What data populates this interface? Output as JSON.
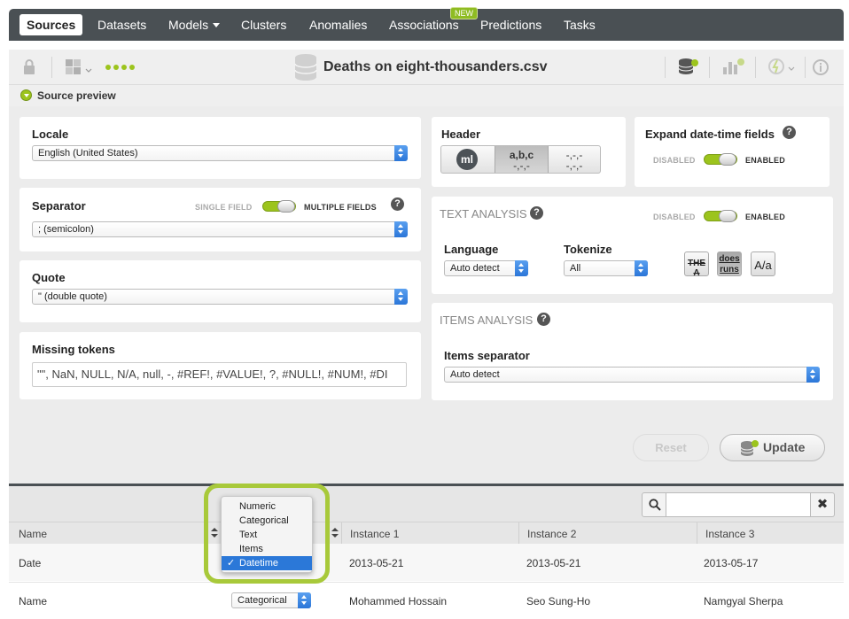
{
  "nav": {
    "items": [
      {
        "label": "Sources",
        "active": true
      },
      {
        "label": "Datasets"
      },
      {
        "label": "Models",
        "has_dropdown": true
      },
      {
        "label": "Clusters"
      },
      {
        "label": "Anomalies"
      },
      {
        "label": "Associations",
        "badge": "NEW"
      },
      {
        "label": "Predictions"
      },
      {
        "label": "Tasks"
      }
    ]
  },
  "toolbar": {
    "title": "Deaths on eight-thousanders.csv",
    "icons": [
      "lock-icon",
      "configure-source-icon",
      "more-dots-icon",
      "database-icon",
      "dataset-config-icon",
      "chart-icon",
      "one-click-icon",
      "info-icon"
    ]
  },
  "preview": {
    "label": "Source preview"
  },
  "locale": {
    "title": "Locale",
    "value": "English (United States)"
  },
  "separator": {
    "title": "Separator",
    "toggle_left": "SINGLE FIELD",
    "toggle_right": "MULTIPLE FIELDS",
    "value": "; (semicolon)"
  },
  "quote": {
    "title": "Quote",
    "value": "\" (double quote)"
  },
  "missing_tokens": {
    "title": "Missing tokens",
    "value": "\"\", NaN, NULL, N/A, null, -, #REF!, #VALUE!, ?, #NULL!, #NUM!, #DI"
  },
  "header": {
    "title": "Header",
    "ml_label": "ml",
    "btn2_top": "a,b,c",
    "btn2_bottom": "-,-,-",
    "btn3_top": "-,-,-",
    "btn3_bottom": "-,-,-"
  },
  "expand_datetime": {
    "title": "Expand date-time fields",
    "disabled": "DISABLED",
    "enabled": "ENABLED"
  },
  "text_analysis": {
    "title": "TEXT ANALYSIS",
    "disabled": "DISABLED",
    "enabled": "ENABLED",
    "language_label": "Language",
    "language_value": "Auto detect",
    "tokenize_label": "Tokenize",
    "tokenize_value": "All",
    "tok_btn1": "THE A",
    "tok_btn2_top": "does",
    "tok_btn2_bottom": "runs",
    "tok_btn3": "A/a"
  },
  "items_analysis": {
    "title": "ITEMS ANALYSIS",
    "separator_label": "Items separator",
    "separator_value": "Auto detect"
  },
  "buttons": {
    "reset": "Reset",
    "update": "Update"
  },
  "table": {
    "columns": [
      "Name",
      "Instance 1",
      "Instance 2",
      "Instance 3"
    ],
    "rows": [
      {
        "name": "Date",
        "type": "Datetime",
        "i1": "2013-05-21",
        "i2": "2013-05-21",
        "i3": "2013-05-17"
      },
      {
        "name": "Name",
        "type": "Categorical",
        "i1": "Mohammed Hossain",
        "i2": "Seo Sung-Ho",
        "i3": "Namgyal Sherpa"
      }
    ]
  },
  "type_dropdown": {
    "options": [
      "Numeric",
      "Categorical",
      "Text",
      "Items",
      "Datetime"
    ],
    "selected": "Datetime",
    "check": "✓"
  },
  "colors": {
    "accent_green": "#9cc41d",
    "nav_bg": "#4a5054",
    "select_blue": "#2b76d8"
  }
}
